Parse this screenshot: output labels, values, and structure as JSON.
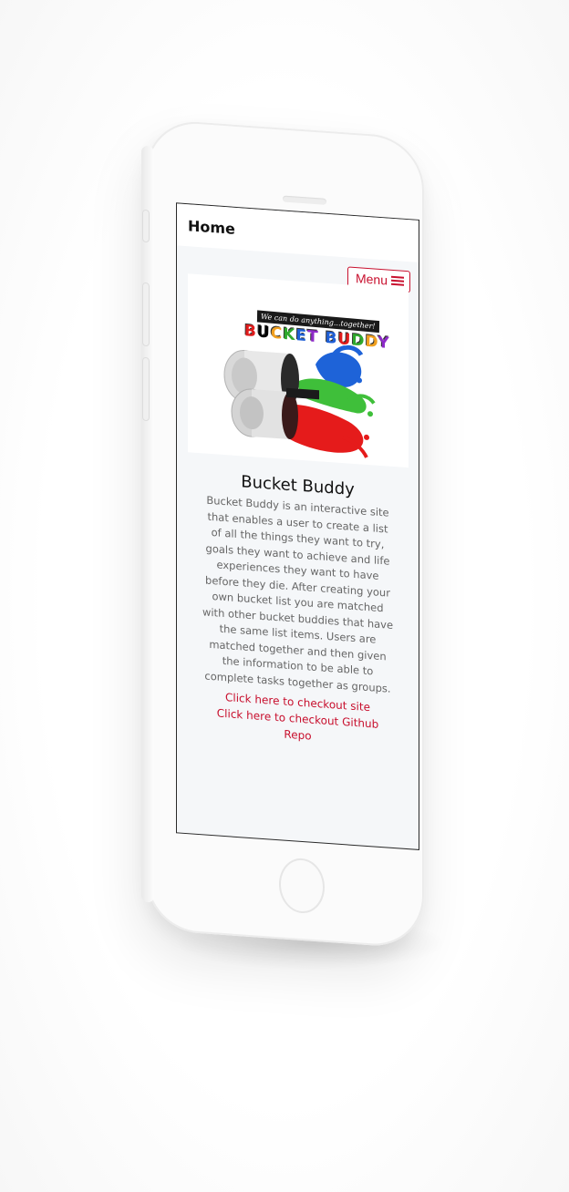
{
  "header": {
    "home_label": "Home",
    "menu_label": "Menu"
  },
  "hero": {
    "banner_text": "We can do anything...together!",
    "title_letters": [
      "B",
      "U",
      "C",
      "K",
      "E",
      "T",
      " ",
      "B",
      "U",
      "D",
      "D",
      "Y"
    ]
  },
  "main": {
    "title": "Bucket Buddy",
    "description": "Bucket Buddy is an interactive site that enables a user to create a list of all the things they want to try, goals they want to achieve and life experiences they want to have before they die. After creating your own bucket list you are matched with other bucket buddies that have the same list items. Users are matched together and then given the information to be able to complete tasks together as groups.",
    "link_site": "Click here to checkout site",
    "link_repo": "Click here to checkout Github Repo"
  },
  "colors": {
    "accent": "#c8102e",
    "text": "#111111",
    "muted": "#666666",
    "screen_bg": "#f5f7f9"
  },
  "icons": {
    "menu": "hamburger-icon"
  }
}
